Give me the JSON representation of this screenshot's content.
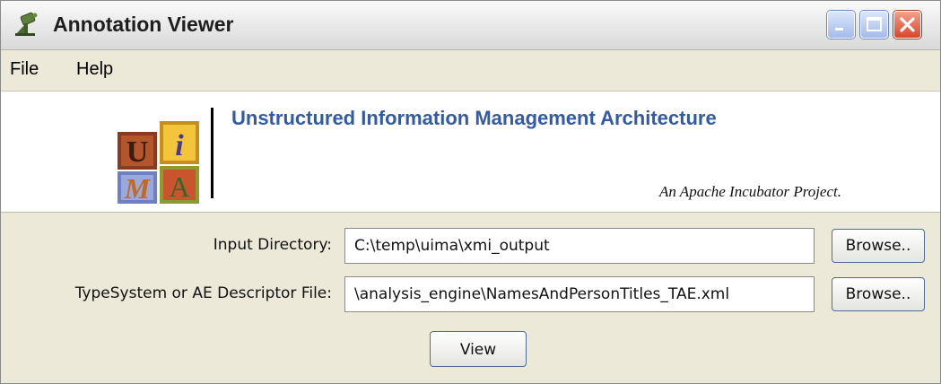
{
  "window": {
    "title": "Annotation Viewer",
    "app_icon": "uima-app-icon",
    "controls": [
      "minimize-icon",
      "maximize-icon",
      "close-icon"
    ]
  },
  "menubar": {
    "items": [
      "File",
      "Help"
    ]
  },
  "banner": {
    "logo_text": "UIMA",
    "title": "Unstructured Information Management Architecture",
    "subtitle": "An Apache Incubator Project.",
    "title_color": "#325aa6"
  },
  "form": {
    "input_directory": {
      "label": "Input Directory:",
      "value": "C:\\temp\\uima\\xmi_output",
      "button": "Browse.."
    },
    "descriptor_file": {
      "label": "TypeSystem or AE Descriptor File:",
      "value": "\\analysis_engine\\NamesAndPersonTitles_TAE.xml",
      "button": "Browse.."
    },
    "view_button": "View"
  }
}
